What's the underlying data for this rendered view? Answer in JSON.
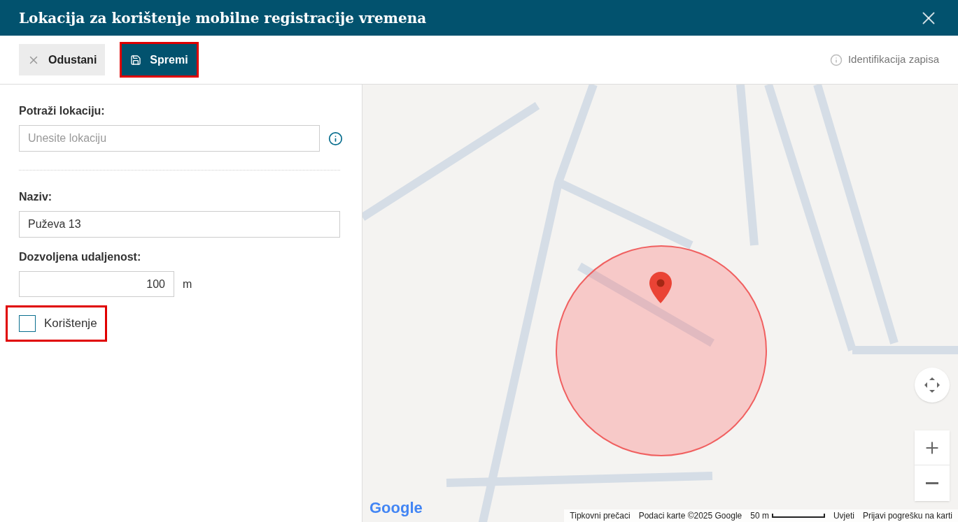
{
  "window": {
    "title": "Lokacija za korištenje mobilne registracije vremena"
  },
  "toolbar": {
    "cancel": "Odustani",
    "save": "Spremi",
    "save_highlighted": true,
    "record_id": "Identifikacija zapisa"
  },
  "form": {
    "search_label": "Potraži lokaciju:",
    "search_placeholder": "Unesite lokaciju",
    "name_label": "Naziv:",
    "name_value": "Puževa 13",
    "distance_label": "Dozvoljena udaljenost:",
    "distance_value": "100",
    "distance_unit": "m",
    "usage": {
      "label": "Korištenje",
      "checked": false,
      "highlighted": true
    }
  },
  "map": {
    "logo": "Google",
    "attribution": [
      {
        "kind": "link",
        "text": "Tipkovni prečaci"
      },
      {
        "kind": "text",
        "text": "Podaci karte ©2025 Google"
      },
      {
        "kind": "scale",
        "text": "50 m"
      },
      {
        "kind": "link",
        "text": "Uvjeti"
      },
      {
        "kind": "link",
        "text": "Prijavi pogrešku na karti"
      }
    ]
  }
}
